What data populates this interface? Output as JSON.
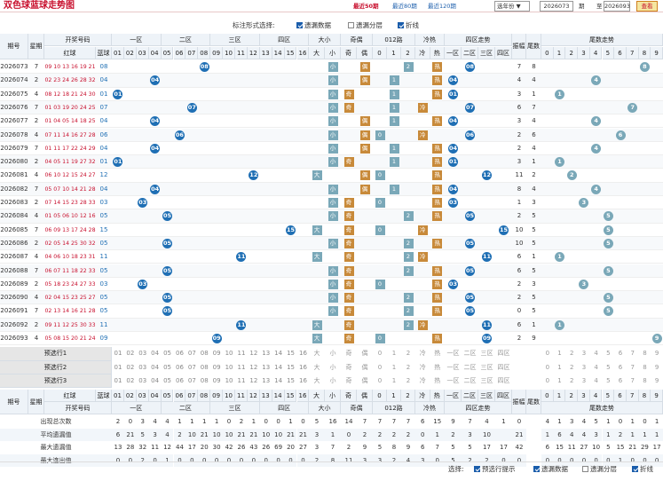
{
  "title": "双色球蓝球走势图",
  "top": {
    "links": [
      "最近50期",
      "最近80期",
      "最近120期"
    ],
    "year": "选年份",
    "from": "2026073",
    "to_label": "至",
    "to": "2026093",
    "period_label": "期",
    "query": "查看"
  },
  "options": {
    "label": "标注形式选择:",
    "items": [
      "遗漏数据",
      "遗漏分层",
      "折线"
    ],
    "states": [
      true,
      false,
      true
    ]
  },
  "headers": {
    "period": "期号",
    "week": "星期",
    "nums": "开奖号码",
    "red": "红球",
    "blue": "蓝球",
    "zones": [
      "一区",
      "二区",
      "三区",
      "四区"
    ],
    "size": "大小",
    "oe": "奇偶",
    "r012": "012路",
    "hc": "冷热",
    "zone_trend": "四区走势",
    "amp": "振幅",
    "tail": "尾数",
    "tail_trend": "尾数走势",
    "big": "大",
    "small": "小",
    "odd": "奇",
    "even": "偶",
    "cold": "冷",
    "hot": "热",
    "zlabels": [
      "一区",
      "二区",
      "三区",
      "四区"
    ],
    "blue_nums": [
      "01",
      "02",
      "03",
      "04",
      "05",
      "06",
      "07",
      "08",
      "09",
      "10",
      "11",
      "12",
      "13",
      "14",
      "15",
      "16"
    ],
    "r_vals": [
      "0",
      "1",
      "2"
    ],
    "tails": [
      "0",
      "1",
      "2",
      "3",
      "4",
      "5",
      "6",
      "7",
      "8",
      "9"
    ]
  },
  "rows": [
    {
      "p": "2026073",
      "w": "7",
      "red": "09 10 13 16 19 21",
      "b": "08",
      "bi": 7,
      "sz": "小",
      "oe": "偶",
      "r": 2,
      "hc": "热",
      "z": 1,
      "amp": "7",
      "tail": "8"
    },
    {
      "p": "2026074",
      "w": "2",
      "red": "02 23 24 26 28 32",
      "b": "04",
      "bi": 3,
      "sz": "小",
      "oe": "偶",
      "r": 1,
      "hc": "热",
      "z": 0,
      "amp": "4",
      "tail": "4"
    },
    {
      "p": "2026075",
      "w": "4",
      "red": "08 12 18 21 24 30",
      "b": "01",
      "bi": 0,
      "sz": "小",
      "oe": "奇",
      "r": 1,
      "hc": "热",
      "z": 0,
      "amp": "3",
      "tail": "1"
    },
    {
      "p": "2026076",
      "w": "7",
      "red": "01 03 19 20 24 25",
      "b": "07",
      "bi": 6,
      "sz": "小",
      "oe": "奇",
      "r": 1,
      "hc": "冷",
      "z": 1,
      "amp": "6",
      "tail": "7"
    },
    {
      "p": "2026077",
      "w": "2",
      "red": "01 04 05 14 18 25",
      "b": "04",
      "bi": 3,
      "sz": "小",
      "oe": "偶",
      "r": 1,
      "hc": "热",
      "z": 0,
      "amp": "3",
      "tail": "4"
    },
    {
      "p": "2026078",
      "w": "4",
      "red": "07 11 14 16 27 28",
      "b": "06",
      "bi": 5,
      "sz": "小",
      "oe": "偶",
      "r": 0,
      "hc": "冷",
      "z": 1,
      "amp": "2",
      "tail": "6"
    },
    {
      "p": "2026079",
      "w": "7",
      "red": "01 11 17 22 24 29",
      "b": "04",
      "bi": 3,
      "sz": "小",
      "oe": "偶",
      "r": 1,
      "hc": "热",
      "z": 0,
      "amp": "2",
      "tail": "4"
    },
    {
      "p": "2026080",
      "w": "2",
      "red": "04 05 11 19 27 32",
      "b": "01",
      "bi": 0,
      "sz": "小",
      "oe": "奇",
      "r": 1,
      "hc": "热",
      "z": 0,
      "amp": "3",
      "tail": "1"
    },
    {
      "p": "2026081",
      "w": "4",
      "red": "06 10 12 15 24 27",
      "b": "12",
      "bi": 11,
      "sz": "大",
      "oe": "偶",
      "r": 0,
      "hc": "热",
      "z": 2,
      "amp": "11",
      "tail": "2"
    },
    {
      "p": "2026082",
      "w": "7",
      "red": "05 07 10 14 21 28",
      "b": "04",
      "bi": 3,
      "sz": "小",
      "oe": "偶",
      "r": 1,
      "hc": "热",
      "z": 0,
      "amp": "8",
      "tail": "4"
    },
    {
      "p": "2026083",
      "w": "2",
      "red": "07 14 15 23 28 33",
      "b": "03",
      "bi": 2,
      "sz": "小",
      "oe": "奇",
      "r": 0,
      "hc": "热",
      "z": 0,
      "amp": "1",
      "tail": "3"
    },
    {
      "p": "2026084",
      "w": "4",
      "red": "01 05 06 10 12 16",
      "b": "05",
      "bi": 4,
      "sz": "小",
      "oe": "奇",
      "r": 2,
      "hc": "热",
      "z": 1,
      "amp": "2",
      "tail": "5"
    },
    {
      "p": "2026085",
      "w": "7",
      "red": "06 09 13 17 24 28",
      "b": "15",
      "bi": 14,
      "sz": "大",
      "oe": "奇",
      "r": 0,
      "hc": "冷",
      "z": 3,
      "amp": "10",
      "tail": "5"
    },
    {
      "p": "2026086",
      "w": "2",
      "red": "02 05 14 25 30 32",
      "b": "05",
      "bi": 4,
      "sz": "小",
      "oe": "奇",
      "r": 2,
      "hc": "热",
      "z": 1,
      "amp": "10",
      "tail": "5"
    },
    {
      "p": "2026087",
      "w": "4",
      "red": "04 06 10 18 23 31",
      "b": "11",
      "bi": 10,
      "sz": "大",
      "oe": "奇",
      "r": 2,
      "hc": "冷",
      "z": 2,
      "amp": "6",
      "tail": "1"
    },
    {
      "p": "2026088",
      "w": "7",
      "red": "06 07 11 18 22 33",
      "b": "05",
      "bi": 4,
      "sz": "小",
      "oe": "奇",
      "r": 2,
      "hc": "热",
      "z": 1,
      "amp": "6",
      "tail": "5"
    },
    {
      "p": "2026089",
      "w": "2",
      "red": "05 18 23 24 27 33",
      "b": "03",
      "bi": 2,
      "sz": "小",
      "oe": "奇",
      "r": 0,
      "hc": "热",
      "z": 0,
      "amp": "2",
      "tail": "3"
    },
    {
      "p": "2026090",
      "w": "4",
      "red": "02 04 15 23 25 27",
      "b": "05",
      "bi": 4,
      "sz": "小",
      "oe": "奇",
      "r": 2,
      "hc": "热",
      "z": 1,
      "amp": "2",
      "tail": "5"
    },
    {
      "p": "2026091",
      "w": "7",
      "red": "02 13 14 16 21 28",
      "b": "05",
      "bi": 4,
      "sz": "小",
      "oe": "奇",
      "r": 2,
      "hc": "热",
      "z": 1,
      "amp": "0",
      "tail": "5"
    },
    {
      "p": "2026092",
      "w": "2",
      "red": "09 11 12 25 30 33",
      "b": "11",
      "bi": 10,
      "sz": "大",
      "oe": "奇",
      "r": 2,
      "hc": "冷",
      "z": 2,
      "amp": "6",
      "tail": "1"
    },
    {
      "p": "2026093",
      "w": "4",
      "red": "05 08 15 20 21 24",
      "b": "09",
      "bi": 8,
      "sz": "大",
      "oe": "奇",
      "r": 0,
      "hc": "热",
      "z": 2,
      "amp": "2",
      "tail": "9"
    }
  ],
  "presel": [
    "预选行1",
    "预选行2",
    "预选行3"
  ],
  "stats": [
    {
      "label": "出现总次数",
      "vals": [
        "2",
        "0",
        "3",
        "4",
        "4",
        "1",
        "1",
        "1",
        "1",
        "0",
        "2",
        "1",
        "0",
        "0",
        "1",
        "0",
        "5",
        "16",
        "14",
        "7",
        "7",
        "7",
        "7",
        "6",
        "15",
        "9",
        "7",
        "4",
        "1",
        "0",
        "4",
        "1",
        "3",
        "4",
        "5",
        "1",
        "0",
        "1",
        "0",
        "1"
      ]
    },
    {
      "label": "平均遗漏值",
      "vals": [
        "6",
        "21",
        "5",
        "3",
        "4",
        "2",
        "10",
        "21",
        "10",
        "10",
        "21",
        "21",
        "10",
        "10",
        "21",
        "21",
        "3",
        "1",
        "0",
        "2",
        "2",
        "2",
        "2",
        "0",
        "1",
        "2",
        "3",
        "10",
        "",
        "21",
        "1",
        "6",
        "4",
        "4",
        "3",
        "1",
        "2",
        "1",
        "1",
        "1"
      ]
    },
    {
      "label": "最大遗漏值",
      "vals": [
        "13",
        "28",
        "32",
        "11",
        "12",
        "44",
        "17",
        "20",
        "30",
        "42",
        "26",
        "43",
        "26",
        "69",
        "20",
        "27",
        "3",
        "7",
        "2",
        "9",
        "5",
        "8",
        "9",
        "6",
        "7",
        "5",
        "5",
        "17",
        "17",
        "42",
        "6",
        "15",
        "11",
        "27",
        "10",
        "5",
        "15",
        "21",
        "29",
        "17"
      ]
    },
    {
      "label": "最大连出值",
      "vals": [
        "0",
        "0",
        "2",
        "0",
        "1",
        "0",
        "0",
        "0",
        "0",
        "0",
        "0",
        "0",
        "0",
        "0",
        "0",
        "0",
        "2",
        "8",
        "11",
        "3",
        "3",
        "2",
        "4",
        "3",
        "0",
        "5",
        "2",
        "2",
        "0",
        "0",
        "0",
        "0",
        "0",
        "0",
        "0",
        "0",
        "1",
        "0",
        "0",
        "0"
      ]
    }
  ],
  "bottom": {
    "label": "选择:",
    "items": [
      "预选行提示",
      "遗漏数据",
      "遗漏分层",
      "折线"
    ],
    "states": [
      true,
      true,
      false,
      true
    ]
  },
  "colors": {
    "accent": "#c8102e",
    "blue_ball": "#1f6fb4"
  }
}
